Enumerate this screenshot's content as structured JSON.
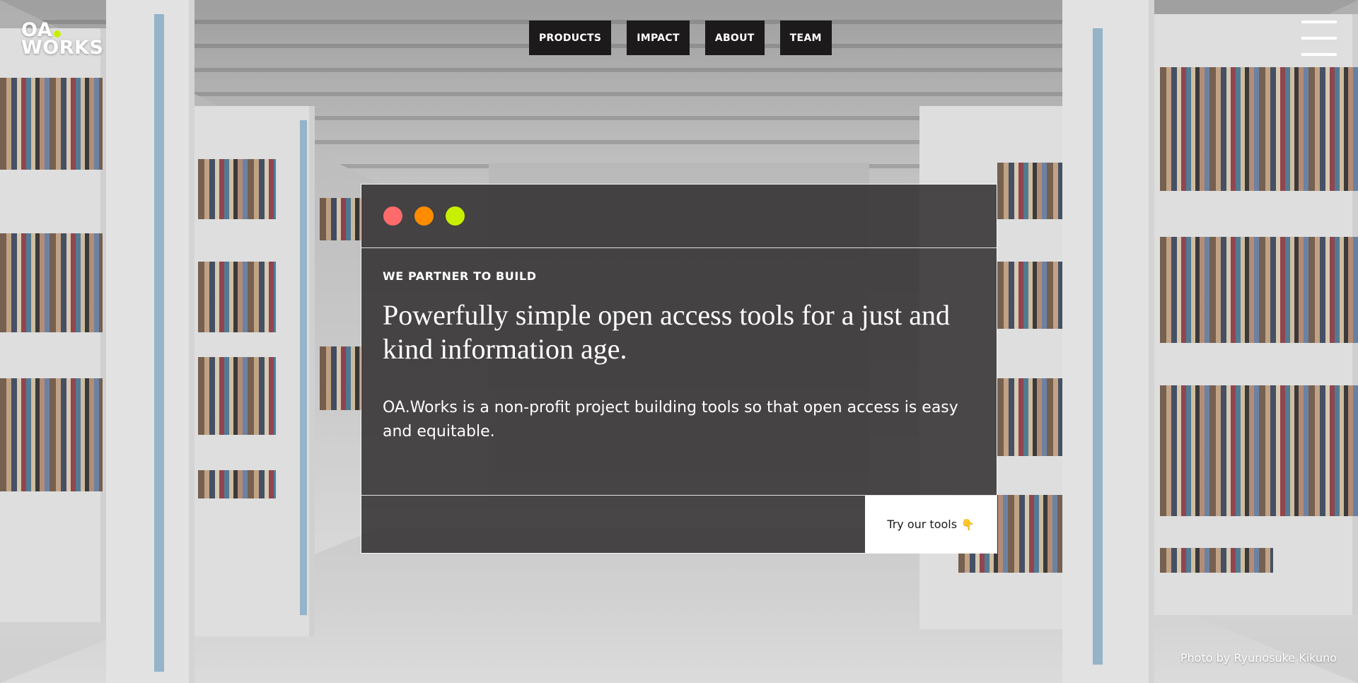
{
  "header": {
    "logo_line1": "OA",
    "logo_line2": "WORKS",
    "nav": [
      "PRODUCTS",
      "IMPACT",
      "ABOUT",
      "TEAM"
    ],
    "menu_icon": "hamburger-menu-icon"
  },
  "card": {
    "window_dots": [
      {
        "name": "red-dot",
        "color": "#ff6b6b"
      },
      {
        "name": "orange-dot",
        "color": "#ff8c00"
      },
      {
        "name": "lime-dot",
        "color": "#c7f000"
      }
    ],
    "eyebrow": "WE PARTNER TO BUILD",
    "headline": "Powerfully simple open access tools for a just and kind information age.",
    "description": "OA.Works is a non-profit project building tools so that open access is easy and equitable.",
    "cta_label": "Try our tools",
    "cta_icon": "pointing-down-hand-icon",
    "cta_glyph": "👇"
  },
  "photo_credit": "Photo by Ryunosuke Kikuno",
  "colors": {
    "accent": "#c7f000",
    "dark": "#1c1a1a"
  }
}
